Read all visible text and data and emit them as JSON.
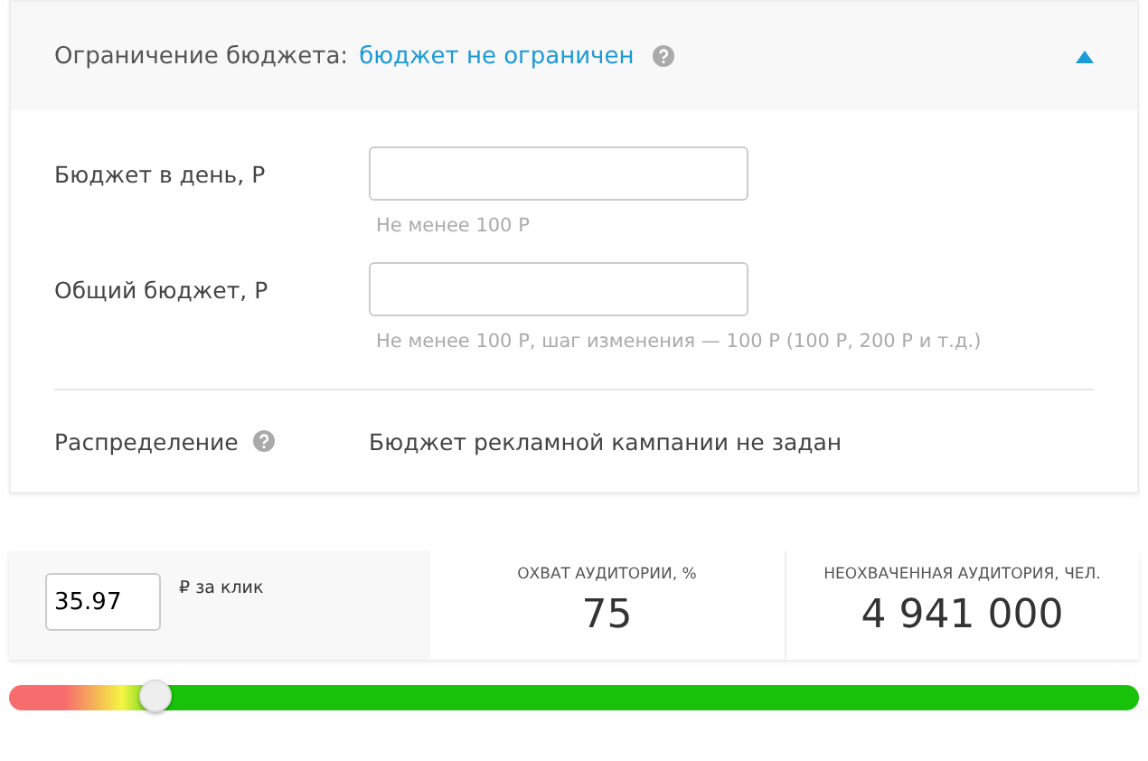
{
  "budget_limit": {
    "label": "Ограничение бюджета:",
    "value": "бюджет не ограничен",
    "expanded": true
  },
  "fields": [
    {
      "label": "Бюджет в день, Р",
      "hint": "Не менее 100 Р"
    },
    {
      "label": "Общий бюджет, Р",
      "hint": "Не менее 100 Р, шаг изменения — 100 Р (100 Р, 200 Р и т.д.)"
    }
  ],
  "distribution": {
    "label": "Распределение",
    "value": "Бюджет рекламной кампании не задан"
  },
  "bid": {
    "value": "35.97",
    "unit": "₽ за клик"
  },
  "stats": [
    {
      "label": "ОХВАТ АУДИТОРИИ, %",
      "value": "75"
    },
    {
      "label": "НЕОХВАЧЕННАЯ АУДИТОРИЯ, ЧЕЛ.",
      "value": "4 941 000"
    }
  ],
  "slider": {
    "level": 0.13
  }
}
